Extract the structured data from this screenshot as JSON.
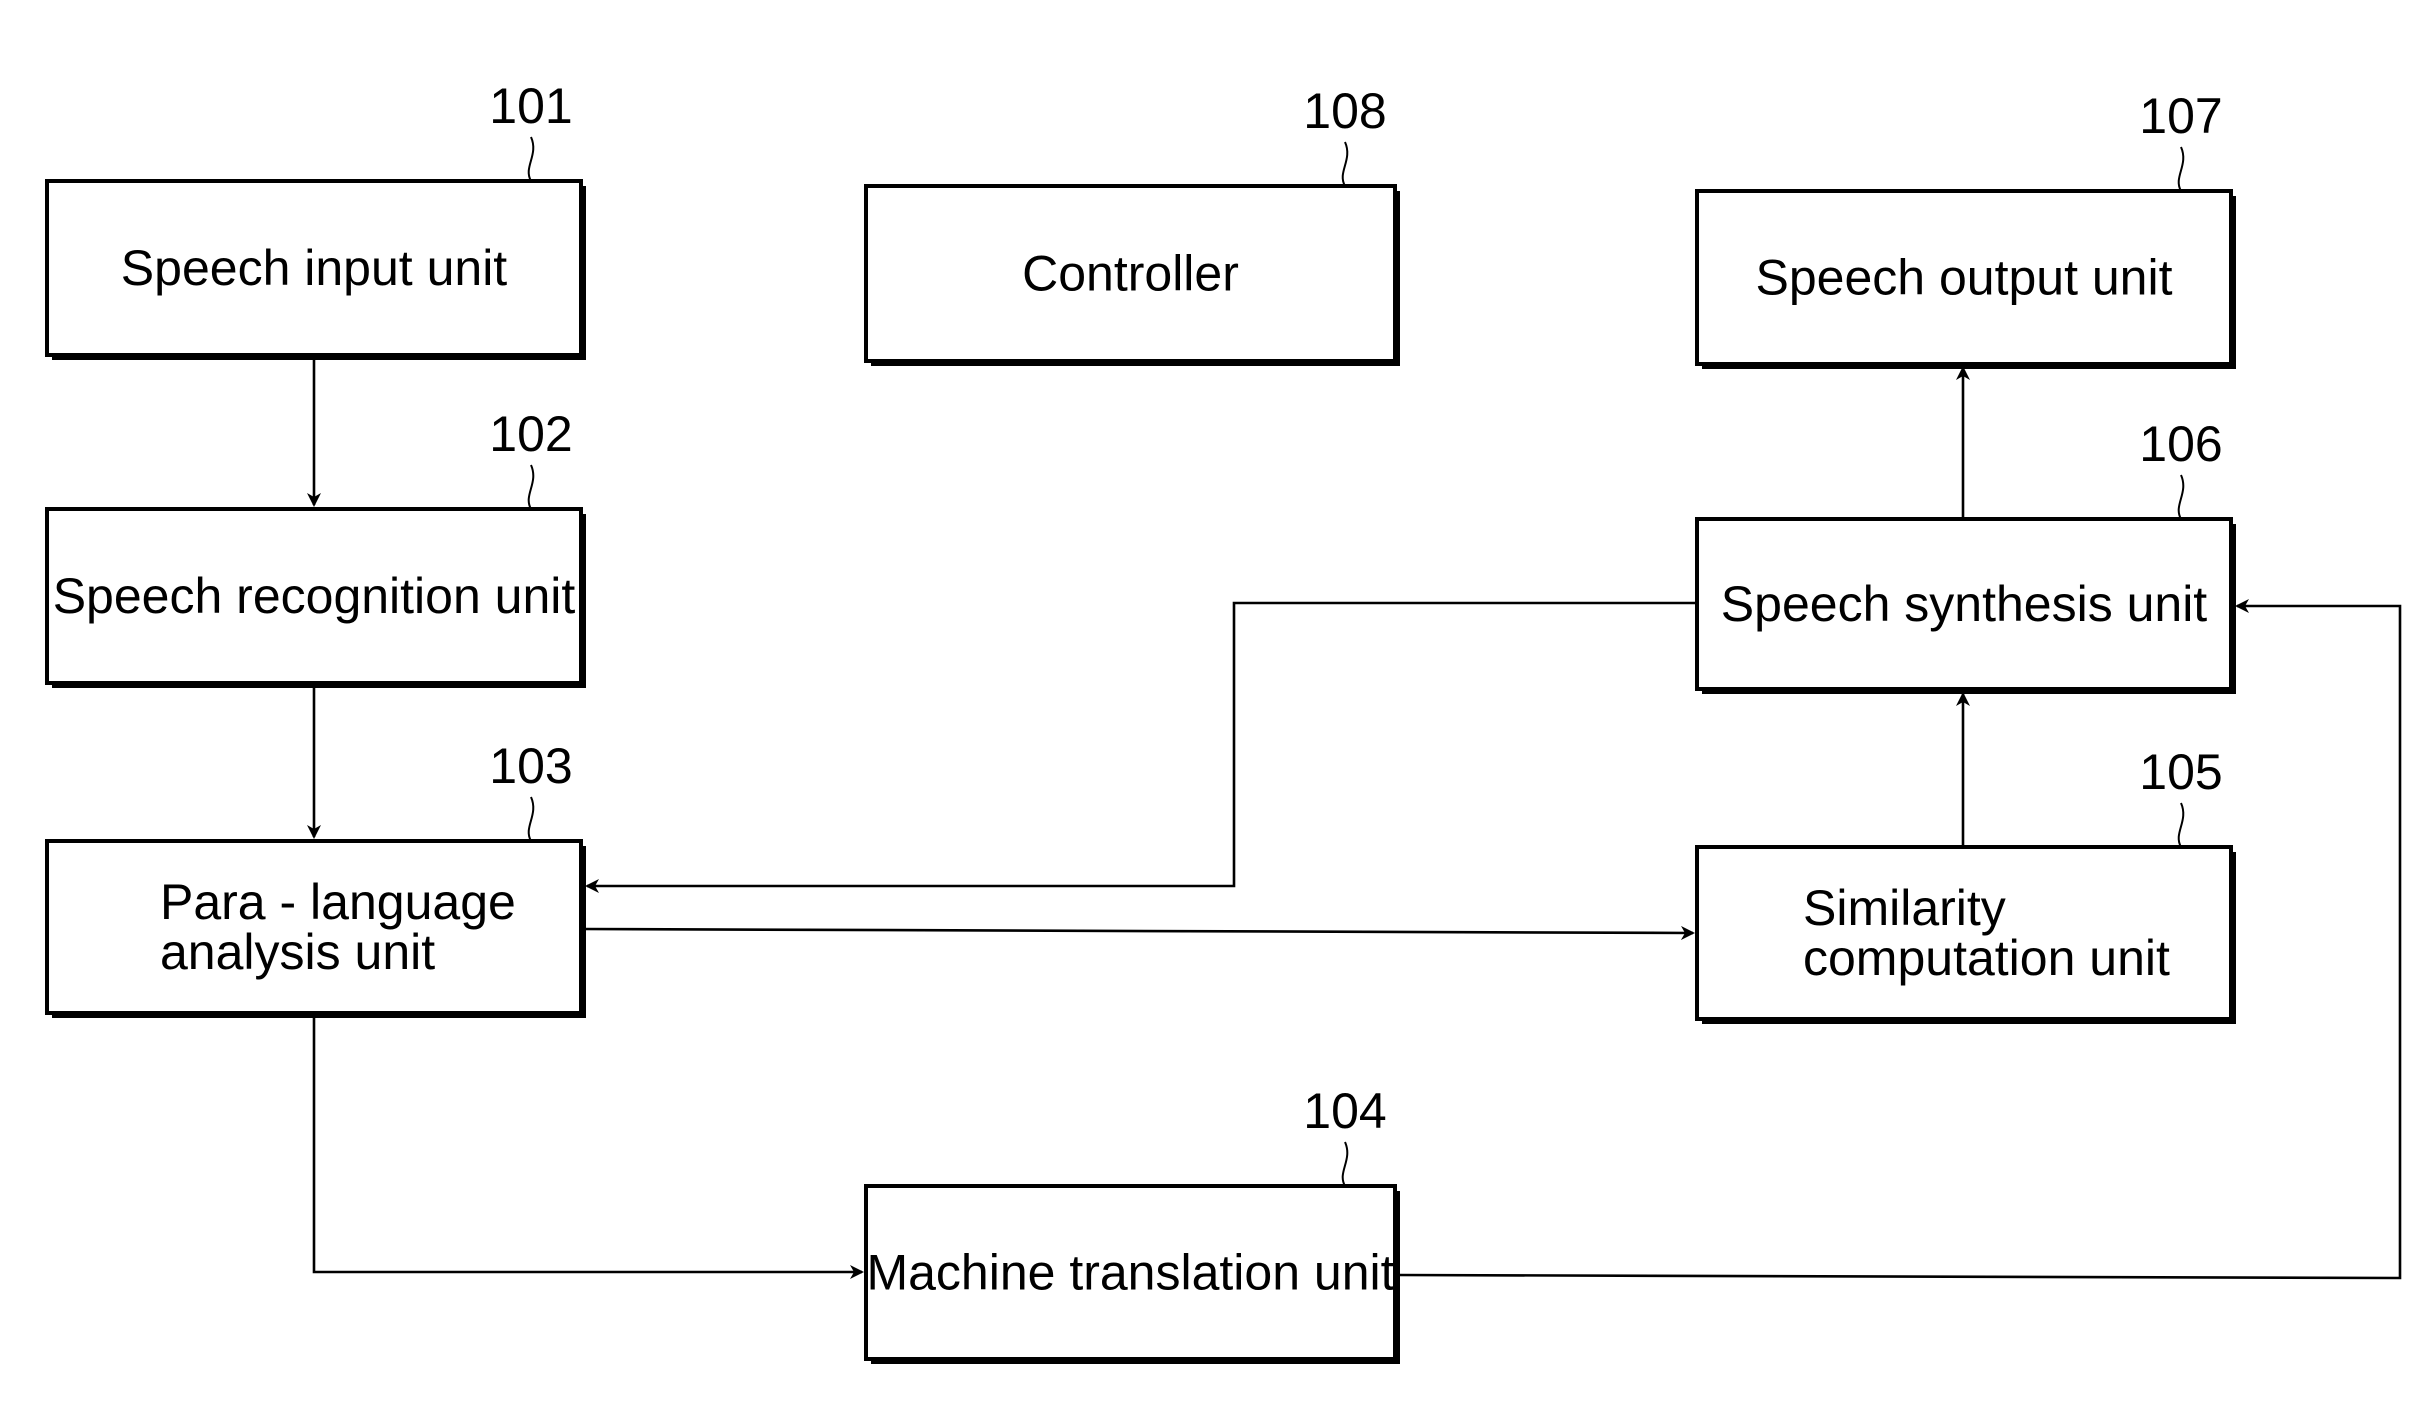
{
  "diagram": {
    "type": "block-diagram",
    "blocks": [
      {
        "id": "101",
        "ref": "101",
        "lines": [
          "Speech input unit"
        ]
      },
      {
        "id": "102",
        "ref": "102",
        "lines": [
          "Speech recognition unit"
        ]
      },
      {
        "id": "103",
        "ref": "103",
        "lines": [
          "Para - language",
          "analysis unit"
        ]
      },
      {
        "id": "104",
        "ref": "104",
        "lines": [
          "Machine translation unit"
        ]
      },
      {
        "id": "105",
        "ref": "105",
        "lines": [
          "Similarity",
          "computation unit"
        ]
      },
      {
        "id": "106",
        "ref": "106",
        "lines": [
          "Speech synthesis unit"
        ]
      },
      {
        "id": "107",
        "ref": "107",
        "lines": [
          "Speech output unit"
        ]
      },
      {
        "id": "108",
        "ref": "108",
        "lines": [
          "Controller"
        ]
      }
    ],
    "connections": [
      {
        "from": "101",
        "to": "102"
      },
      {
        "from": "102",
        "to": "103"
      },
      {
        "from": "103",
        "to": "104"
      },
      {
        "from": "103",
        "to": "105"
      },
      {
        "from": "106",
        "to": "103"
      },
      {
        "from": "105",
        "to": "106"
      },
      {
        "from": "104",
        "to": "106"
      },
      {
        "from": "106",
        "to": "107"
      }
    ]
  }
}
